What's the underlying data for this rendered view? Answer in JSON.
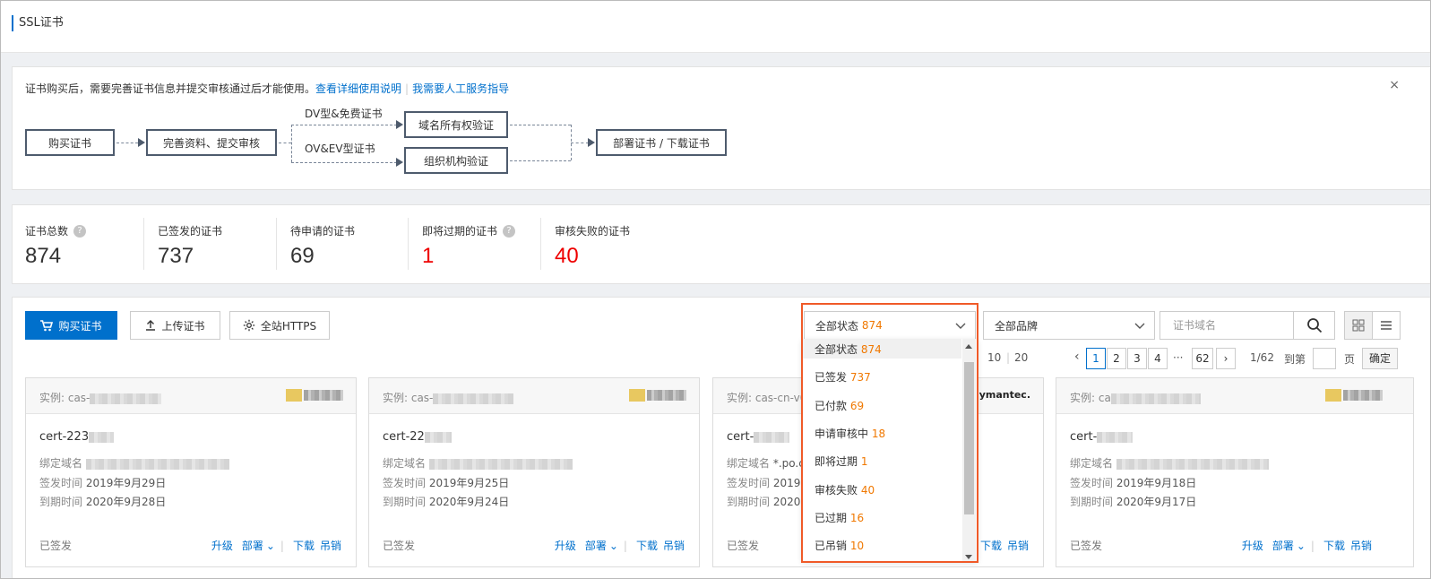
{
  "header": {
    "title": "SSL证书"
  },
  "notice": {
    "text": "证书购买后，需要完善证书信息并提交审核通过后才能使用。",
    "link1": "查看详细使用说明",
    "sep": "|",
    "link2": "我需要人工服务指导",
    "close": "×",
    "flow": {
      "step1": "购买证书",
      "step2": "完善资料、提交审核",
      "branch1_label": "DV型&免费证书",
      "branch2_label": "OV&EV型证书",
      "step3a": "域名所有权验证",
      "step3b": "组织机构验证",
      "step4": "部署证书 / 下载证书"
    }
  },
  "stats": [
    {
      "label": "证书总数",
      "value": "874",
      "help": true,
      "red": false
    },
    {
      "label": "已签发的证书",
      "value": "737",
      "help": false,
      "red": false
    },
    {
      "label": "待申请的证书",
      "value": "69",
      "help": false,
      "red": false
    },
    {
      "label": "即将过期的证书",
      "value": "1",
      "help": true,
      "red": true
    },
    {
      "label": "审核失败的证书",
      "value": "40",
      "help": false,
      "red": true
    }
  ],
  "toolbar": {
    "buy": "购买证书",
    "upload": "上传证书",
    "https": "全站HTTPS",
    "status_label": "全部状态",
    "status_count": "874",
    "brand_select": "全部品牌",
    "search_placeholder": "证书域名"
  },
  "pager": {
    "size10": "10",
    "size20": "20",
    "pages": [
      "1",
      "2",
      "3",
      "4"
    ],
    "ellipsis": "···",
    "last": "62",
    "info": "1/62",
    "goto": "到第",
    "page_unit": "页",
    "confirm": "确定"
  },
  "cards": [
    {
      "inst_prefix": "实例: cas-",
      "name_prefix": "cert-223",
      "domain_label": "绑定域名",
      "issue_label": "签发时间",
      "issue": "2019年9月29日",
      "expire_label": "到期时间",
      "expire": "2020年9月28日",
      "status": "已签发",
      "brand": ""
    },
    {
      "inst_prefix": "实例: cas-",
      "name_prefix": "cert-22",
      "domain_label": "绑定域名",
      "issue_label": "签发时间",
      "issue": "2019年9月25日",
      "expire_label": "到期时间",
      "expire": "2020年9月24日",
      "status": "已签发",
      "brand": ""
    },
    {
      "inst_prefix": "实例: cas-cn-v0l",
      "name_prefix": "cert-",
      "domain_label": "绑定域名",
      "domain_text": "*.po.c",
      "issue_label": "签发时间",
      "issue": "2019",
      "expire_label": "到期时间",
      "expire": "2020",
      "status": "已签发",
      "brand": "Symantec."
    },
    {
      "inst_prefix": "实例: ca",
      "name_prefix": "cert-",
      "domain_label": "绑定域名",
      "issue_label": "签发时间",
      "issue": "2019年9月18日",
      "expire_label": "到期时间",
      "expire": "2020年9月17日",
      "status": "已签发",
      "brand": ""
    }
  ],
  "card_actions": {
    "upgrade": "升级",
    "deploy": "部署",
    "download": "下载",
    "revoke": "吊销"
  },
  "dropdown": {
    "options": [
      {
        "label": "全部状态",
        "count": "874"
      },
      {
        "label": "已签发",
        "count": "737"
      },
      {
        "label": "已付款",
        "count": "69"
      },
      {
        "label": "申请审核中",
        "count": "18"
      },
      {
        "label": "即将过期",
        "count": "1"
      },
      {
        "label": "审核失败",
        "count": "40"
      },
      {
        "label": "已过期",
        "count": "16"
      },
      {
        "label": "已吊销",
        "count": "10"
      }
    ]
  },
  "colors": {
    "accent": "#0070cc",
    "orange": "#f07800",
    "red": "#e00000",
    "highlight": "#f05a28"
  }
}
